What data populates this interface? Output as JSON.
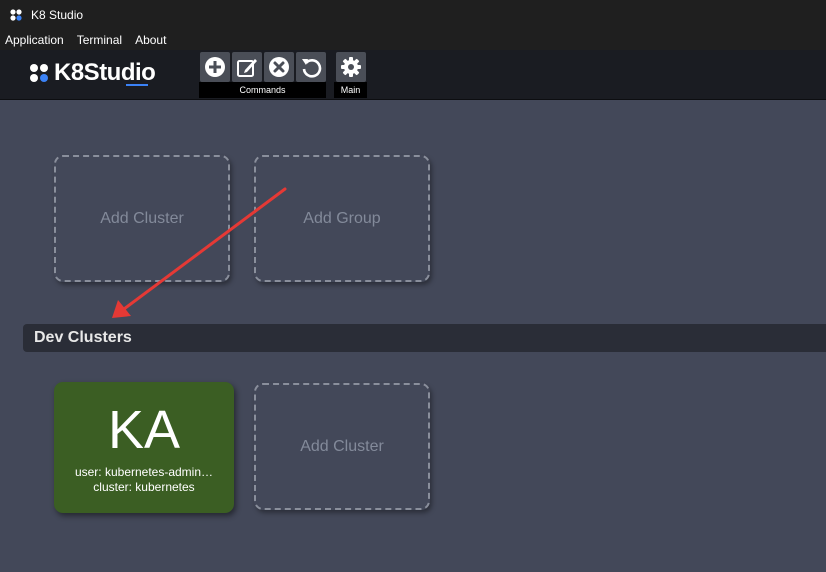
{
  "window": {
    "title": "K8 Studio"
  },
  "menu": {
    "items": [
      "Application",
      "Terminal",
      "About"
    ]
  },
  "logo": {
    "text": "K8Studio"
  },
  "toolbar": {
    "commands_label": "Commands",
    "main_label": "Main",
    "buttons": [
      "add-icon",
      "edit-icon",
      "delete-icon",
      "refresh-icon",
      "gear-icon"
    ]
  },
  "top_tiles": {
    "add_cluster": "Add Cluster",
    "add_group": "Add Group"
  },
  "group": {
    "name": "Dev Clusters",
    "cluster": {
      "initials": "KA",
      "user": "user: kubernetes-admin…",
      "cluster": "cluster: kubernetes",
      "color": "#3b5e23"
    },
    "add_cluster": "Add Cluster"
  },
  "colors": {
    "background": "#434859",
    "annotation_arrow": "#e53935"
  }
}
